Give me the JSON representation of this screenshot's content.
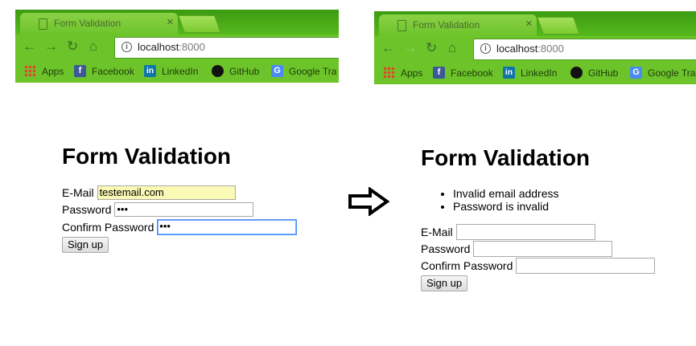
{
  "browser": {
    "tab_title": "Form Validation",
    "close_glyph": "×",
    "url_host": "localhost",
    "url_port": ":8000",
    "bookmarks": [
      "Apps",
      "Facebook",
      "LinkedIn",
      "GitHub",
      "Google Tra"
    ],
    "icons": {
      "back": "←",
      "forward": "→",
      "reload": "↻",
      "home": "⌂",
      "info": "i"
    }
  },
  "before": {
    "heading": "Form Validation",
    "email_label": "E-Mail",
    "email_value": "testemail.com",
    "password_label": "Password",
    "password_value": "•••",
    "confirm_label": "Confirm Password",
    "confirm_value": "•••",
    "submit_label": "Sign up"
  },
  "after": {
    "heading": "Form Validation",
    "errors": [
      "Invalid email address",
      "Password is invalid"
    ],
    "email_label": "E-Mail",
    "email_value": "",
    "password_label": "Password",
    "password_value": "",
    "confirm_label": "Confirm Password",
    "confirm_value": "",
    "submit_label": "Sign up"
  }
}
